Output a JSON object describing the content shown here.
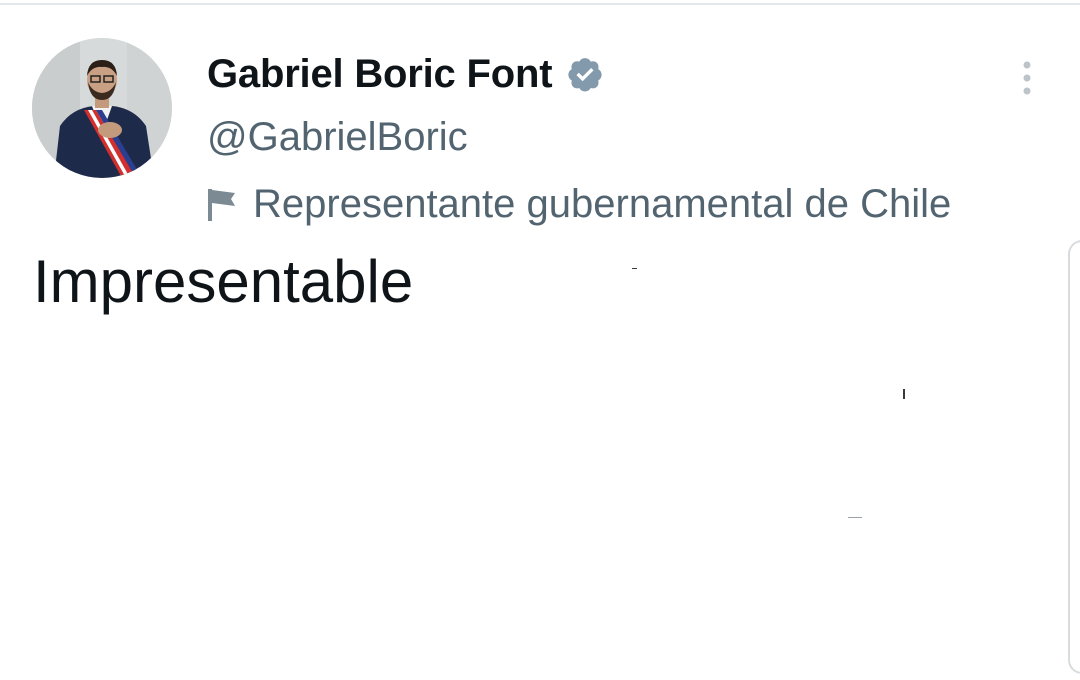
{
  "tweet": {
    "author": {
      "display_name": "Gabriel Boric Font",
      "handle": "@GabrielBoric",
      "verified": true,
      "avatar_icon": "profile-photo",
      "government_label": "Representante gubernamental de Chile"
    },
    "text": "Impresentable"
  },
  "icons": {
    "verified": "verified-badge-icon",
    "label": "flag-icon",
    "menu": "more-options-icon"
  },
  "colors": {
    "text_primary": "#0f1419",
    "text_secondary": "#536471",
    "verified_badge": "#829aab",
    "divider": "#e4e7ea"
  }
}
